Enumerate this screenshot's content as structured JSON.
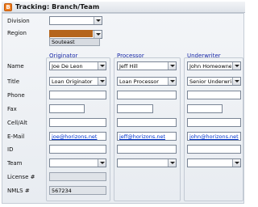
{
  "window": {
    "title": "Tracking: Branch/Team",
    "icon": "app-logo-icon"
  },
  "top_fields": {
    "division": {
      "label": "Division",
      "value": ""
    },
    "region": {
      "label": "Region",
      "value": "",
      "swatch_color": "#b5651d",
      "caption": "Souteast"
    }
  },
  "columns": {
    "originator": {
      "title": "Originator"
    },
    "processor": {
      "title": "Processor"
    },
    "underwriter": {
      "title": "Underwriter"
    }
  },
  "row_labels": {
    "name": "Name",
    "title": "Title",
    "phone": "Phone",
    "fax": "Fax",
    "cell": "Cell/Alt",
    "email": "E-Mail",
    "id": "ID",
    "team": "Team",
    "license": "License #",
    "nmls": "NMLS #"
  },
  "originator": {
    "name": "Joe De Leon",
    "title": "Loan Originator",
    "phone": "",
    "fax": "",
    "cell": "",
    "email": "joe@horizons.net",
    "id": "",
    "team": "",
    "license": "",
    "nmls": "567234"
  },
  "processor": {
    "name": "Jeff Hill",
    "title": "Loan Processor",
    "phone": "",
    "fax": "",
    "cell": "",
    "email": "jeff@horizons.net",
    "id": "",
    "team": ""
  },
  "underwriter": {
    "name": "John Homeowner",
    "title": "Senior Underwriter",
    "phone": "",
    "fax": "",
    "cell": "",
    "email": "john@horizons.net",
    "id": "",
    "team": ""
  }
}
